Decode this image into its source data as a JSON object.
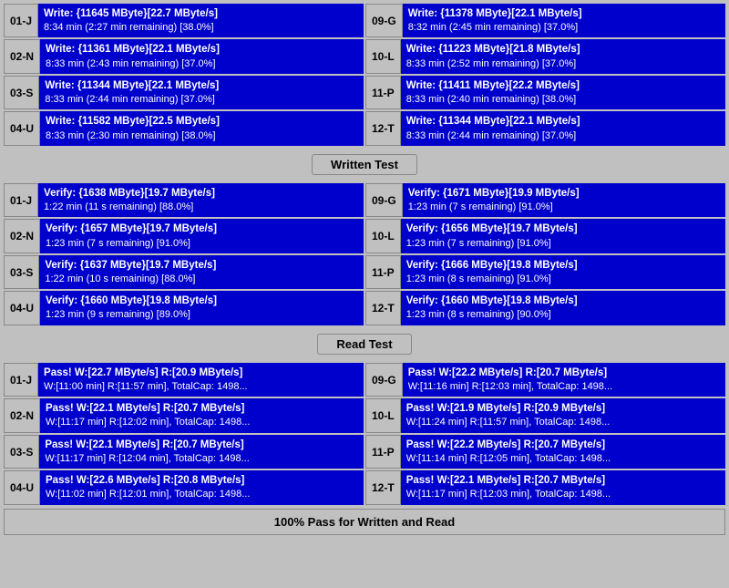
{
  "sections": {
    "write": {
      "rows": [
        {
          "left": {
            "id": "01-J",
            "line1": "Write: {11645 MByte}[22.7 MByte/s]",
            "line2": "8:34 min (2:27 min remaining)  [38.0%]"
          },
          "right": {
            "id": "09-G",
            "line1": "Write: {11378 MByte}[22.1 MByte/s]",
            "line2": "8:32 min (2:45 min remaining)  [37.0%]"
          }
        },
        {
          "left": {
            "id": "02-N",
            "line1": "Write: {11361 MByte}[22.1 MByte/s]",
            "line2": "8:33 min (2:43 min remaining)  [37.0%]"
          },
          "right": {
            "id": "10-L",
            "line1": "Write: {11223 MByte}[21.8 MByte/s]",
            "line2": "8:33 min (2:52 min remaining)  [37.0%]"
          }
        },
        {
          "left": {
            "id": "03-S",
            "line1": "Write: {11344 MByte}[22.1 MByte/s]",
            "line2": "8:33 min (2:44 min remaining)  [37.0%]"
          },
          "right": {
            "id": "11-P",
            "line1": "Write: {11411 MByte}[22.2 MByte/s]",
            "line2": "8:33 min (2:40 min remaining)  [38.0%]"
          }
        },
        {
          "left": {
            "id": "04-U",
            "line1": "Write: {11582 MByte}[22.5 MByte/s]",
            "line2": "8:33 min (2:30 min remaining)  [38.0%]"
          },
          "right": {
            "id": "12-T",
            "line1": "Write: {11344 MByte}[22.1 MByte/s]",
            "line2": "8:33 min (2:44 min remaining)  [37.0%]"
          }
        }
      ],
      "divider": "Written Test"
    },
    "verify": {
      "rows": [
        {
          "left": {
            "id": "01-J",
            "line1": "Verify: {1638 MByte}[19.7 MByte/s]",
            "line2": "1:22 min (11 s remaining)   [88.0%]"
          },
          "right": {
            "id": "09-G",
            "line1": "Verify: {1671 MByte}[19.9 MByte/s]",
            "line2": "1:23 min (7 s remaining)   [91.0%]"
          }
        },
        {
          "left": {
            "id": "02-N",
            "line1": "Verify: {1657 MByte}[19.7 MByte/s]",
            "line2": "1:23 min (7 s remaining)   [91.0%]"
          },
          "right": {
            "id": "10-L",
            "line1": "Verify: {1656 MByte}[19.7 MByte/s]",
            "line2": "1:23 min (7 s remaining)   [91.0%]"
          }
        },
        {
          "left": {
            "id": "03-S",
            "line1": "Verify: {1637 MByte}[19.7 MByte/s]",
            "line2": "1:22 min (10 s remaining)   [88.0%]"
          },
          "right": {
            "id": "11-P",
            "line1": "Verify: {1666 MByte}[19.8 MByte/s]",
            "line2": "1:23 min (8 s remaining)   [91.0%]"
          }
        },
        {
          "left": {
            "id": "04-U",
            "line1": "Verify: {1660 MByte}[19.8 MByte/s]",
            "line2": "1:23 min (9 s remaining)   [89.0%]"
          },
          "right": {
            "id": "12-T",
            "line1": "Verify: {1660 MByte}[19.8 MByte/s]",
            "line2": "1:23 min (8 s remaining)   [90.0%]"
          }
        }
      ],
      "divider": "Read Test"
    },
    "pass": {
      "rows": [
        {
          "left": {
            "id": "01-J",
            "line1": "Pass! W:[22.7 MByte/s] R:[20.9 MByte/s]",
            "line2": "W:[11:00 min] R:[11:57 min], TotalCap: 1498..."
          },
          "right": {
            "id": "09-G",
            "line1": "Pass! W:[22.2 MByte/s] R:[20.7 MByte/s]",
            "line2": "W:[11:16 min] R:[12:03 min], TotalCap: 1498..."
          }
        },
        {
          "left": {
            "id": "02-N",
            "line1": "Pass! W:[22.1 MByte/s] R:[20.7 MByte/s]",
            "line2": "W:[11:17 min] R:[12:02 min], TotalCap: 1498..."
          },
          "right": {
            "id": "10-L",
            "line1": "Pass! W:[21.9 MByte/s] R:[20.9 MByte/s]",
            "line2": "W:[11:24 min] R:[11:57 min], TotalCap: 1498..."
          }
        },
        {
          "left": {
            "id": "03-S",
            "line1": "Pass! W:[22.1 MByte/s] R:[20.7 MByte/s]",
            "line2": "W:[11:17 min] R:[12:04 min], TotalCap: 1498..."
          },
          "right": {
            "id": "11-P",
            "line1": "Pass! W:[22.2 MByte/s] R:[20.7 MByte/s]",
            "line2": "W:[11:14 min] R:[12:05 min], TotalCap: 1498..."
          }
        },
        {
          "left": {
            "id": "04-U",
            "line1": "Pass! W:[22.6 MByte/s] R:[20.8 MByte/s]",
            "line2": "W:[11:02 min] R:[12:01 min], TotalCap: 1498..."
          },
          "right": {
            "id": "12-T",
            "line1": "Pass! W:[22.1 MByte/s] R:[20.7 MByte/s]",
            "line2": "W:[11:17 min] R:[12:03 min], TotalCap: 1498..."
          }
        }
      ]
    }
  },
  "status_bar": "100% Pass for Written and Read"
}
